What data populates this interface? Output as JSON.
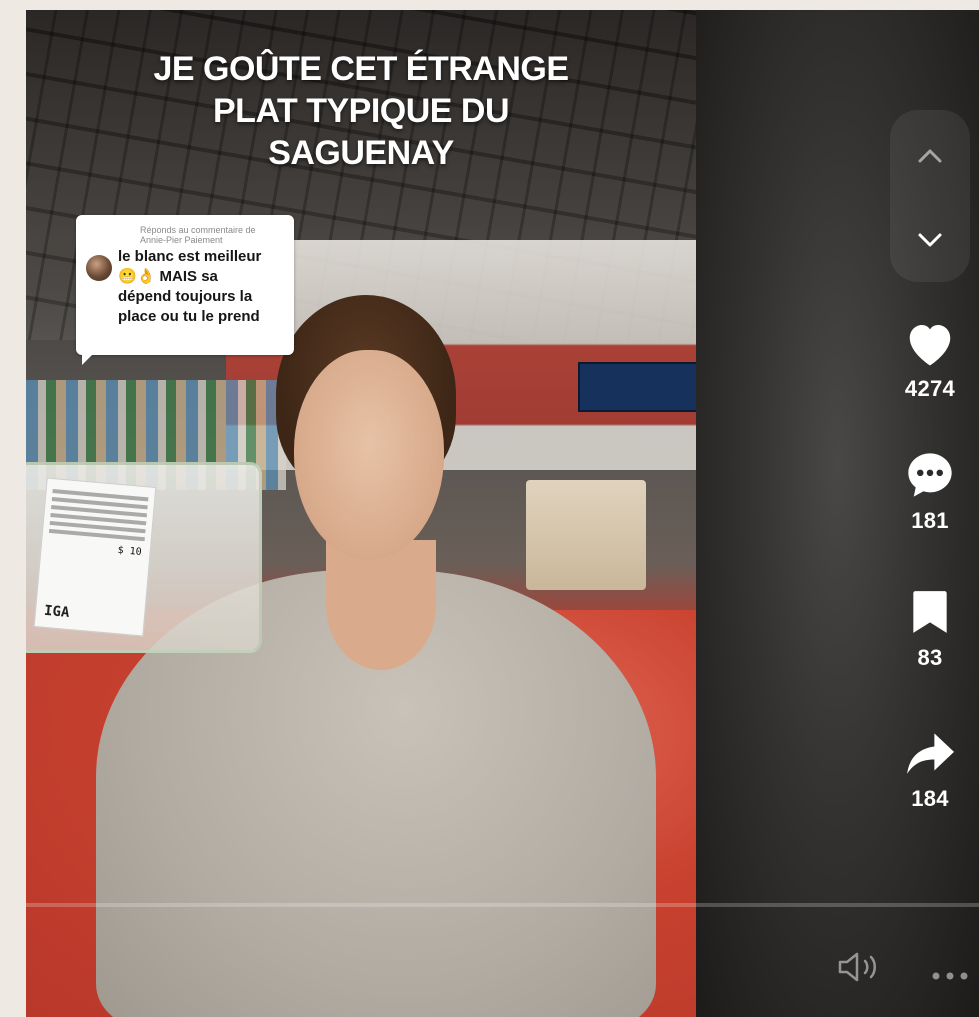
{
  "video": {
    "title_lines": [
      "JE GOÛTE CET ÉTRANGE",
      "PLAT TYPIQUE DU",
      "SAGUENAY"
    ],
    "progress": 0.0
  },
  "reply": {
    "caption": "Réponds au commentaire de",
    "author": "Annie-Pier Paiement",
    "text_lines": [
      "le blanc est meilleur",
      "😬👌 MAIS sa",
      "dépend toujours la",
      "place ou tu le prend"
    ]
  },
  "cake_label": {
    "brand": "IGA",
    "price": "$ 10"
  },
  "actions": {
    "likes": "4274",
    "comments": "181",
    "saves": "83",
    "shares": "184"
  },
  "icons": {
    "up": "chevron-up-icon",
    "down": "chevron-down-icon",
    "like": "heart-icon",
    "comment": "comment-icon",
    "save": "bookmark-icon",
    "share": "share-icon",
    "volume": "volume-icon",
    "more": "more-icon"
  },
  "colors": {
    "accent": "#ffffff",
    "floor": "#c9412f"
  }
}
